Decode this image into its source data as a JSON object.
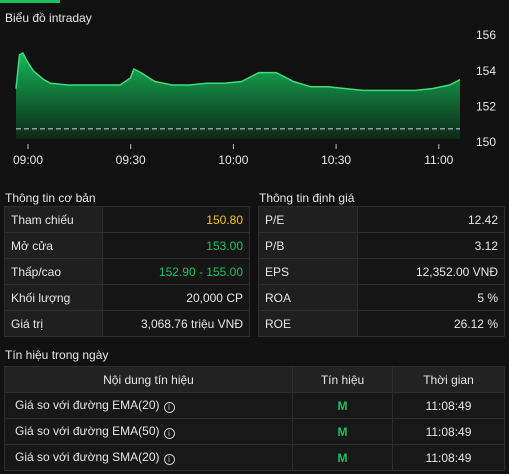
{
  "colors": {
    "accent": "#16c15f",
    "reference": "#f5c400",
    "background": "#111111"
  },
  "chart": {
    "title": "Biểu đồ intraday",
    "chart_data": {
      "type": "area",
      "ylim": [
        150,
        157
      ],
      "yticks": [
        "156",
        "154",
        "152",
        "150"
      ],
      "xticks": [
        "09:00",
        "09:30",
        "10:00",
        "10:30",
        "11:00"
      ],
      "reference_value": 150.8,
      "series": [
        {
          "x": [
            0,
            1,
            2,
            3,
            5,
            8,
            10,
            15,
            20,
            25,
            30,
            33,
            34,
            36,
            40,
            45,
            50,
            55,
            60,
            65,
            70,
            75,
            80,
            85,
            90,
            95,
            100,
            105,
            110,
            115,
            120,
            125,
            128
          ],
          "y": [
            153.0,
            154.9,
            155.0,
            154.6,
            154.0,
            153.5,
            153.3,
            153.2,
            153.2,
            153.2,
            153.2,
            153.6,
            154.1,
            153.9,
            153.4,
            153.2,
            153.2,
            153.3,
            153.3,
            153.4,
            153.9,
            153.9,
            153.4,
            153.1,
            153.1,
            153.0,
            152.9,
            152.9,
            152.9,
            152.9,
            153.0,
            153.2,
            153.5
          ]
        }
      ]
    }
  },
  "basic_info": {
    "title": "Thông tin cơ bản",
    "rows": [
      {
        "label": "Tham chiếu",
        "value": "150.80"
      },
      {
        "label": "Mở cửa",
        "value": "153.00"
      },
      {
        "label": "Thấp/cao",
        "value": "152.90 - 155.00"
      },
      {
        "label": "Khối lượng",
        "value": "20,000 CP"
      },
      {
        "label": "Giá trị",
        "value": "3,068.76 triệu VNĐ"
      }
    ]
  },
  "valuation_info": {
    "title": "Thông tin định giá",
    "rows": [
      {
        "label": "P/E",
        "value": "12.42"
      },
      {
        "label": "P/B",
        "value": "3.12"
      },
      {
        "label": "EPS",
        "value": "12,352.00 VNĐ"
      },
      {
        "label": "ROA",
        "value": "5 %"
      },
      {
        "label": "ROE",
        "value": "26.12 %"
      }
    ]
  },
  "signals": {
    "title": "Tín hiệu trong ngày",
    "headers": {
      "content": "Nội dung tín hiệu",
      "signal": "Tín hiệu",
      "time": "Thời gian"
    },
    "rows": [
      {
        "content": "Giá so với đường EMA(20)",
        "signal": "M",
        "time": "11:08:49"
      },
      {
        "content": "Giá so với đường EMA(50)",
        "signal": "M",
        "time": "11:08:49"
      },
      {
        "content": "Giá so với đường SMA(20)",
        "signal": "M",
        "time": "11:08:49"
      }
    ]
  }
}
